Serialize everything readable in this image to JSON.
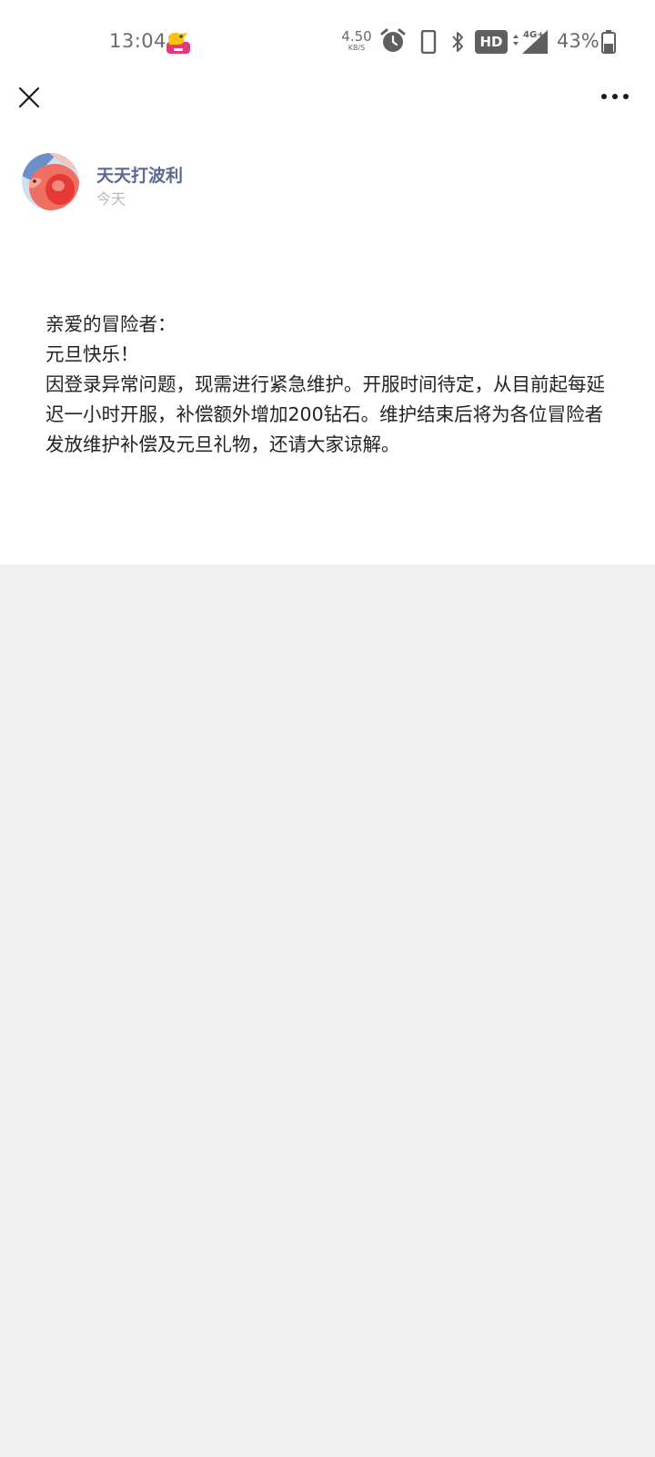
{
  "status_bar": {
    "time": "13:04",
    "net_speed_value": "4.50",
    "net_speed_unit": "KB/S",
    "hd_label": "HD",
    "network_type": "4G+",
    "battery_percent": "43%",
    "battery_level": 0.43,
    "icons": [
      "app-notification-icon",
      "alarm-icon",
      "phone-icon",
      "bluetooth-icon",
      "signal-icon",
      "battery-icon"
    ]
  },
  "nav": {
    "close_icon": "close-icon",
    "more_icon": "more-icon"
  },
  "post": {
    "author_name": "天天打波利",
    "post_time": "今天",
    "lines": [
      "亲爱的冒险者：",
      "元旦快乐！",
      "因登录异常问题，现需进行紧急维护。开服时间待定，从目前起每延迟一小时开服，补偿额外增加200钻石。维护结束后将为各位冒险者发放维护补偿及元旦礼物，还请大家谅解。"
    ]
  },
  "colors": {
    "author_name": "#5b6a92",
    "page_background": "#f0f0f0",
    "card_background": "#ffffff"
  }
}
